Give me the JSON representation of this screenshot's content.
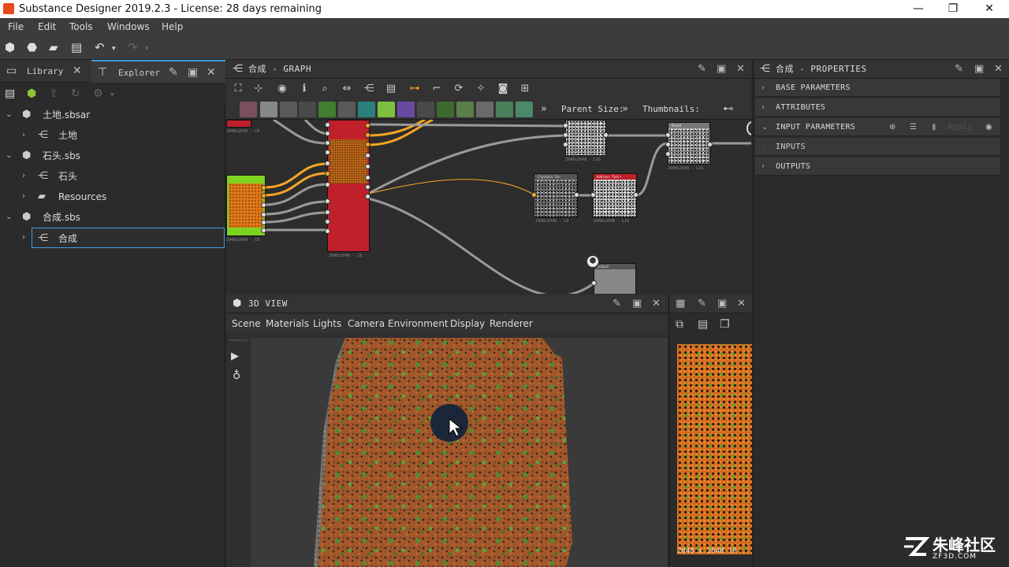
{
  "window": {
    "title": "Substance Designer 2019.2.3 - License: 28 days remaining",
    "minimize": "—",
    "maximize": "❐",
    "close": "✕"
  },
  "menu": [
    "File",
    "Edit",
    "Tools",
    "Windows",
    "Help"
  ],
  "left_panel": {
    "tabs": [
      {
        "label": "Library",
        "icon": "folder-icon"
      },
      {
        "label": "Explorer",
        "icon": "tree-icon",
        "active": true
      }
    ],
    "tree": [
      {
        "label": "土地.sbsar",
        "level": 0,
        "icon": "package-icon",
        "expanded": true
      },
      {
        "label": "土地",
        "level": 1,
        "icon": "graph-icon"
      },
      {
        "label": "石头.sbs",
        "level": 0,
        "icon": "package-icon",
        "expanded": true
      },
      {
        "label": "石头",
        "level": 1,
        "icon": "graph-icon"
      },
      {
        "label": "Resources",
        "level": 1,
        "icon": "folder-icon"
      },
      {
        "label": "合成.sbs",
        "level": 0,
        "icon": "package-icon",
        "expanded": true
      },
      {
        "label": "合成",
        "level": 1,
        "icon": "graph-icon",
        "selected": true
      }
    ]
  },
  "graph": {
    "title_name": "合成",
    "title_suffix": " - GRAPH",
    "parent_size_label": "Parent Size:",
    "thumbnails_label": "Thumbnails:",
    "overflow": "»"
  },
  "graph_nodes": {
    "n1_label": "2048x2048 - L16",
    "n2_label": "2048x2048 - L16",
    "n3_head": "Crystals Co~",
    "n3_label": "2048x2048 - L8",
    "n4_head": "Address Tool~",
    "n4_label": "2048x2048 - L16",
    "n5_head": "Blend",
    "n6_label": "2048x2048 - C8",
    "n7_label": "2048x2048 - C8",
    "n8_head": "Output"
  },
  "properties": {
    "title_name": "合成",
    "title_suffix": " - PROPERTIES",
    "sections": [
      {
        "label": "BASE PARAMETERS",
        "enabled": true
      },
      {
        "label": "ATTRIBUTES",
        "enabled": true
      },
      {
        "label": "INPUT PARAMETERS",
        "enabled": true,
        "expanded": true
      },
      {
        "label": "INPUTS",
        "enabled": false
      },
      {
        "label": "OUTPUTS",
        "enabled": true
      }
    ],
    "apply_label": "Apply"
  },
  "view3d": {
    "title": "3D VIEW",
    "menu": [
      "Scene",
      "Materials",
      "Lights",
      "Camera",
      "Environment",
      "Display",
      "Renderer"
    ]
  },
  "view2d": {
    "resolution_label": "2048 x 2048 (R"
  },
  "watermark": {
    "text": "朱峰社区",
    "sub": "ZF3D.COM"
  },
  "colors": {
    "accent": "#39a0e8",
    "node_red": "#c0202a",
    "node_green": "#7ed321",
    "wire_orange": "#f5a623"
  }
}
